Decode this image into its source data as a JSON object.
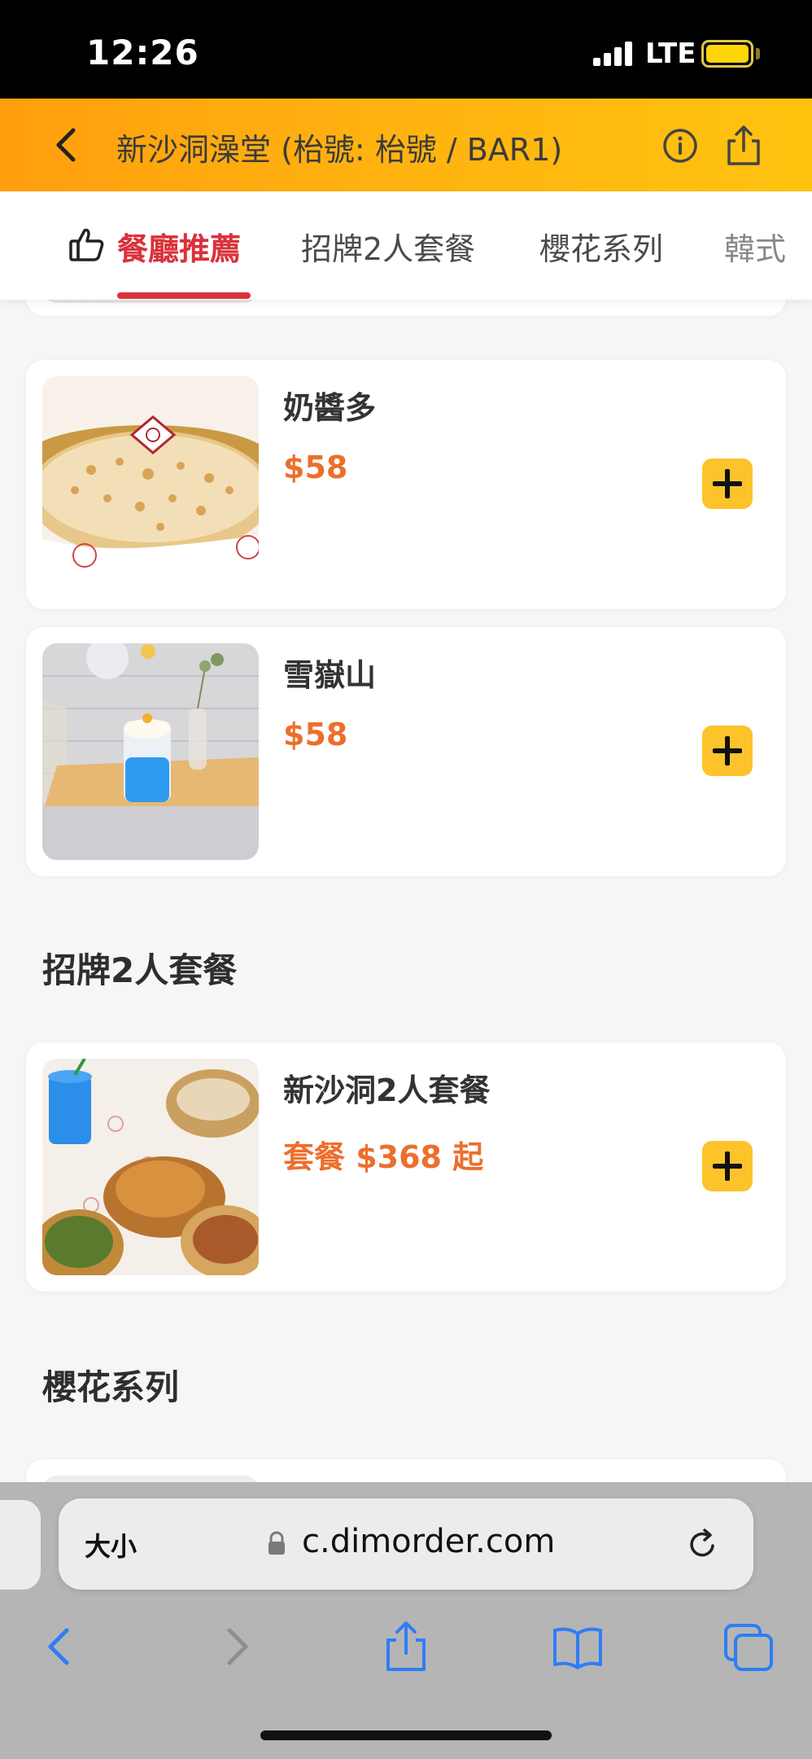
{
  "status_bar": {
    "time": "12:26",
    "network": "LTE"
  },
  "header": {
    "title": "新沙洞澡堂 (枱號: 枱號 / BAR1)"
  },
  "tabs": [
    {
      "label": "餐廳推薦",
      "active": true
    },
    {
      "label": "招牌2人套餐",
      "active": false
    },
    {
      "label": "櫻花系列",
      "active": false
    },
    {
      "label": "韓式",
      "active": false
    }
  ],
  "items": [
    {
      "name": "奶醬多",
      "price": "$58"
    },
    {
      "name": "雪嶽山",
      "price": "$58"
    },
    {
      "name": "新沙洞2人套餐",
      "price": "套餐 $368 起"
    }
  ],
  "sections": [
    {
      "title": "招牌2人套餐"
    },
    {
      "title": "櫻花系列"
    }
  ],
  "browser": {
    "text_size_label": "大小",
    "url": "c.dimorder.com"
  },
  "colors": {
    "header_start": "#ff9e0d",
    "header_end": "#ffc30f",
    "accent_red": "#d9323b",
    "price_orange": "#ec6f2c",
    "add_button": "#fcc32a",
    "ios_blue": "#2f7df6"
  }
}
